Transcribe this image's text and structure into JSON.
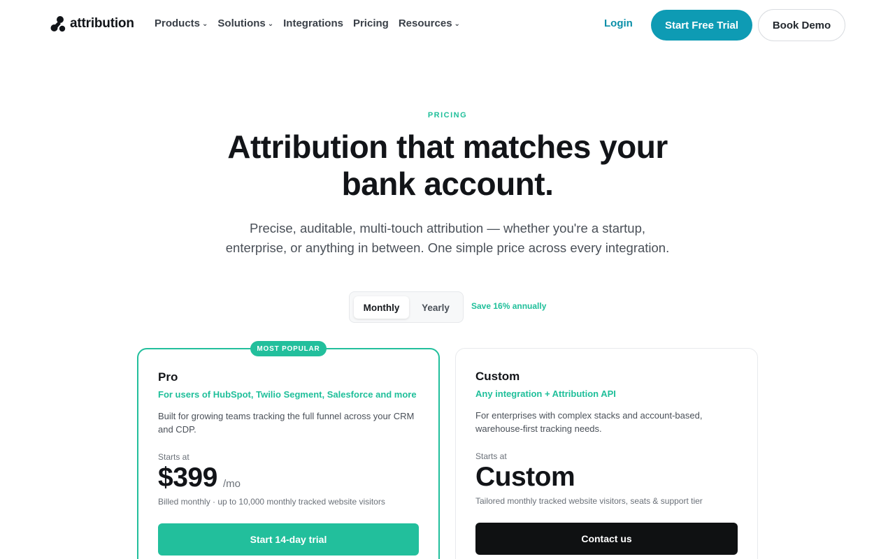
{
  "brand": {
    "name": "attribution"
  },
  "nav": {
    "items": [
      {
        "label": "Products",
        "dropdown": true
      },
      {
        "label": "Solutions",
        "dropdown": true
      },
      {
        "label": "Integrations",
        "dropdown": false
      },
      {
        "label": "Pricing",
        "dropdown": false
      },
      {
        "label": "Resources",
        "dropdown": true
      }
    ],
    "login": "Login",
    "trial": "Start Free Trial",
    "demo": "Book Demo"
  },
  "hero": {
    "eyebrow": "PRICING",
    "headline": "Attribution that matches your bank account.",
    "subhead": "Precise, auditable, multi-touch attribution — whether you're a startup, enterprise, or anything in between. One simple price across every integration."
  },
  "billing": {
    "monthly": "Monthly",
    "yearly": "Yearly",
    "selected": "Monthly",
    "save_note": "Save 16% annually"
  },
  "plans": {
    "pro": {
      "badge": "MOST POPULAR",
      "name": "Pro",
      "tagline": "For users of HubSpot, Twilio Segment, Salesforce and more",
      "description": "Built for growing teams tracking the full funnel across your CRM and CDP.",
      "starts_at": "Starts at",
      "price": "$399",
      "period": "/mo",
      "billing_note": "Billed monthly · up to 10,000 monthly tracked website visitors",
      "cta": "Start 14-day trial"
    },
    "custom": {
      "name": "Custom",
      "tagline": "Any integration + Attribution API",
      "description": "For enterprises with complex stacks and account-based, warehouse-first tracking needs.",
      "starts_at": "Starts at",
      "price": "Custom",
      "billing_note": "Tailored monthly tracked website visitors, seats & support tier",
      "cta": "Contact us"
    }
  },
  "colors": {
    "accent_green": "#22bf9c",
    "accent_teal": "#0e9bb4",
    "dark": "#0f1112"
  },
  "icons": {
    "logo": "attribution-logo-icon",
    "dropdown": "chevron-down-icon"
  }
}
